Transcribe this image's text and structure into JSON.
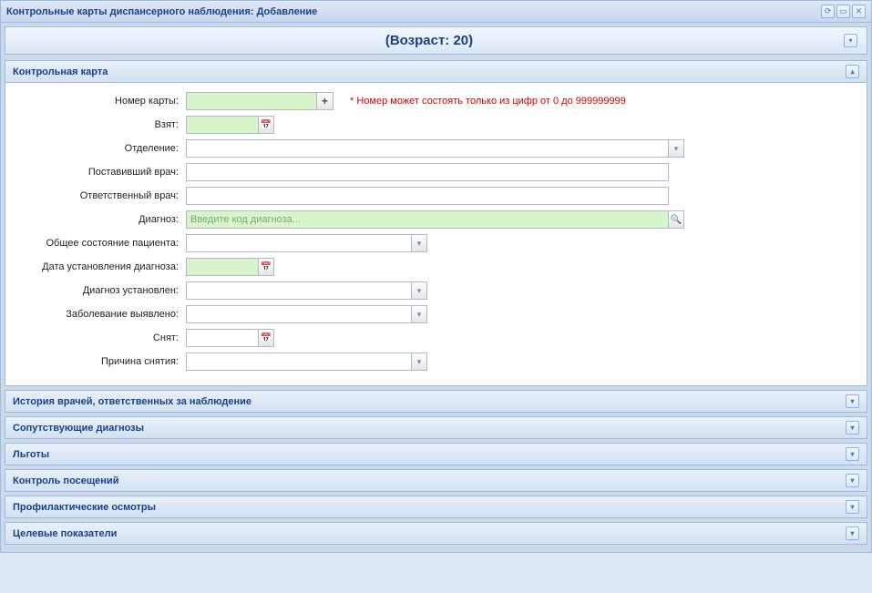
{
  "window": {
    "title": "Контрольные карты диспансерного наблюдения: Добавление",
    "patient_age": "(Возраст: 20)"
  },
  "panels": {
    "main": {
      "title": "Контрольная карта"
    },
    "history": {
      "title": "История врачей, ответственных за наблюдение"
    },
    "comorbid": {
      "title": "Сопутствующие диагнозы"
    },
    "benefits": {
      "title": "Льготы"
    },
    "visits": {
      "title": "Контроль посещений"
    },
    "prophylactic": {
      "title": "Профилактические осмотры"
    },
    "targets": {
      "title": "Целевые показатели"
    }
  },
  "labels": {
    "card_number": "Номер карты:",
    "taken": "Взят:",
    "department": "Отделение:",
    "assigning_doctor": "Поставивший врач:",
    "responsible_doctor": "Ответственный врач:",
    "diagnosis": "Диагноз:",
    "patient_condition": "Общее состояние пациента:",
    "diagnosis_date": "Дата установления диагноза:",
    "diagnosis_set": "Диагноз установлен:",
    "disease_detected": "Заболевание выявлено:",
    "removed": "Снят:",
    "removal_reason": "Причина снятия:"
  },
  "placeholders": {
    "diagnosis": "Введите код диагноза..."
  },
  "hints": {
    "card_number": "* Номер может состоять только из цифр от 0 до 999999999"
  },
  "values": {
    "card_number": "",
    "taken": "",
    "department": "",
    "assigning_doctor": "",
    "responsible_doctor": "",
    "diagnosis": "",
    "patient_condition": "",
    "diagnosis_date": "",
    "diagnosis_set": "",
    "disease_detected": "",
    "removed": "",
    "removal_reason": ""
  }
}
